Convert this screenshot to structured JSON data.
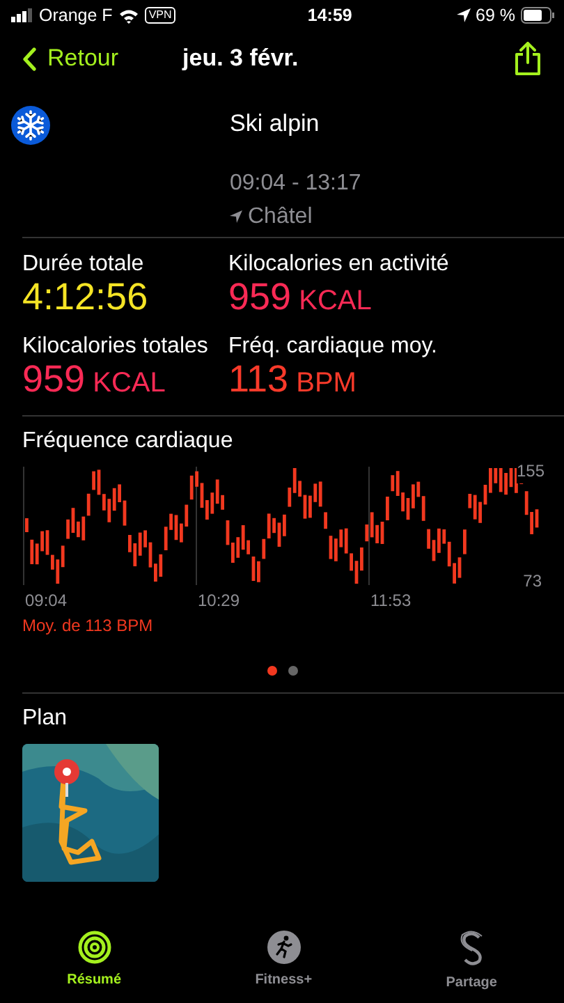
{
  "status_bar": {
    "carrier": "Orange F",
    "vpn": "VPN",
    "time": "14:59",
    "battery": "69 %"
  },
  "nav": {
    "back": "Retour",
    "title": "jeu. 3 févr."
  },
  "workout": {
    "name": "Ski alpin",
    "time_range": "09:04 - 13:17",
    "location": "Châtel"
  },
  "metrics": [
    {
      "label": "Durée totale",
      "value": "4:12:56",
      "color": "#f5e425"
    },
    {
      "label": "Kilocalories en activité",
      "value": "959",
      "unit": "KCAL",
      "color": "#fa2a55"
    },
    {
      "label": "Kilocalories totales",
      "value": "959",
      "unit": "KCAL",
      "color": "#fa2a55"
    },
    {
      "label": "Fréq. cardiaque moy.",
      "value": "113",
      "unit": "BPM",
      "color": "#fa3a2a"
    }
  ],
  "heart_rate": {
    "title": "Fréquence cardiaque",
    "max_label": "155",
    "min_label": "73",
    "time_labels": [
      "09:04",
      "10:29",
      "11:53"
    ],
    "average": "Moy. de 113 BPM"
  },
  "pages": [
    {
      "selected": true
    },
    {
      "selected": false
    }
  ],
  "plan": {
    "title": "Plan"
  },
  "tabs": [
    {
      "label": "Résumé",
      "selected": true
    },
    {
      "label": "Fitness+",
      "selected": false
    },
    {
      "label": "Partage",
      "selected": false
    }
  ]
}
